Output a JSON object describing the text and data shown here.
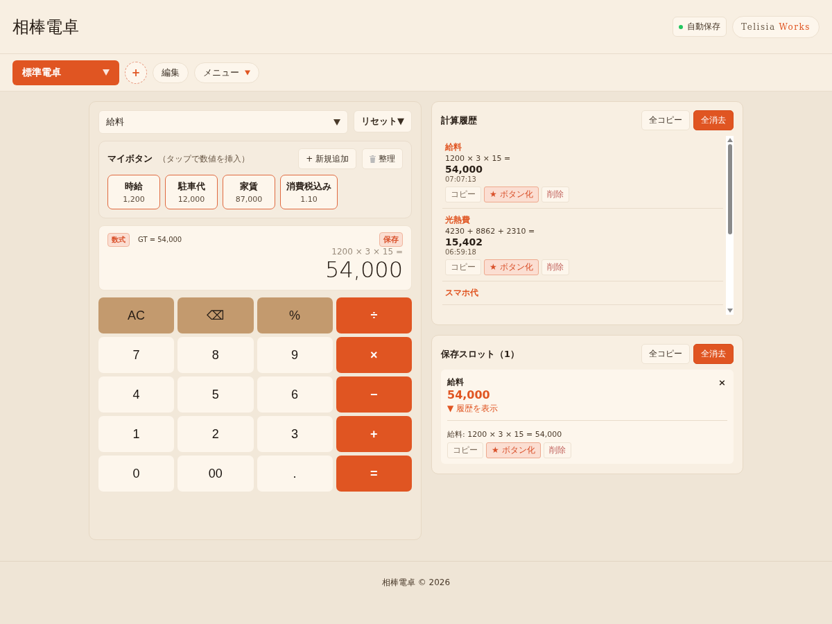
{
  "app": {
    "title": "相棒電卓"
  },
  "autosave": {
    "label": "自動保存",
    "on": true
  },
  "brand": {
    "name": "Telisia",
    "accent": "Works"
  },
  "toolbar": {
    "mode": "標準電卓",
    "add": "+",
    "edit": "編集",
    "menu": "メニュー"
  },
  "calculator": {
    "preset": "給料",
    "reset": "リセット▼",
    "my_buttons": {
      "title": "マイボタン",
      "hint": "（タップで数値を挿入）",
      "add": "+ 新規追加",
      "organize": "整理",
      "items": [
        {
          "label": "時給",
          "value": "1,200"
        },
        {
          "label": "駐車代",
          "value": "12,000"
        },
        {
          "label": "家賃",
          "value": "87,000"
        },
        {
          "label": "消費税込み",
          "value": "1.10"
        }
      ]
    },
    "display": {
      "mode_badge": "数式",
      "gt": "GT = 54,000",
      "save": "保存",
      "expression": "1200 × 3 × 15 =",
      "result": "54,000"
    },
    "keys": [
      {
        "label": "AC",
        "kind": "function"
      },
      {
        "label": "⌫",
        "kind": "function"
      },
      {
        "label": "%",
        "kind": "function"
      },
      {
        "label": "÷",
        "kind": "operator"
      },
      {
        "label": "7",
        "kind": "number"
      },
      {
        "label": "8",
        "kind": "number"
      },
      {
        "label": "9",
        "kind": "number"
      },
      {
        "label": "×",
        "kind": "operator"
      },
      {
        "label": "4",
        "kind": "number"
      },
      {
        "label": "5",
        "kind": "number"
      },
      {
        "label": "6",
        "kind": "number"
      },
      {
        "label": "−",
        "kind": "operator"
      },
      {
        "label": "1",
        "kind": "number"
      },
      {
        "label": "2",
        "kind": "number"
      },
      {
        "label": "3",
        "kind": "number"
      },
      {
        "label": "+",
        "kind": "operator"
      },
      {
        "label": "0",
        "kind": "number"
      },
      {
        "label": "00",
        "kind": "number"
      },
      {
        "label": ".",
        "kind": "number"
      },
      {
        "label": "=",
        "kind": "operator"
      }
    ]
  },
  "history": {
    "title": "計算履歴",
    "copy_all": "全コピー",
    "clear_all": "全消去",
    "items": [
      {
        "name": "給料",
        "expression": "1200 × 3 × 15 =",
        "result": "54,000",
        "time": "07:07:13",
        "actions": [
          "コピー",
          "★ ボタン化",
          "削除"
        ]
      },
      {
        "name": "光熱費",
        "expression": "4230 + 8862 + 2310 =",
        "result": "15,402",
        "time": "06:59:18",
        "actions": [
          "コピー",
          "★ ボタン化",
          "削除"
        ]
      },
      {
        "name": "スマホ代"
      }
    ]
  },
  "slots": {
    "title": "保存スロット（1）",
    "copy_all": "全コピー",
    "clear_all": "全消去",
    "items": [
      {
        "name": "給料",
        "result": "54,000",
        "toggle": "▼ 履歴を表示",
        "close": "×",
        "expanded": true,
        "detail": "給料: 1200 × 3 × 15 = 54,000",
        "actions": [
          "コピー",
          "★ ボタン化",
          "削除"
        ]
      }
    ]
  },
  "footer": {
    "text": "相棒電卓 © 2026"
  }
}
